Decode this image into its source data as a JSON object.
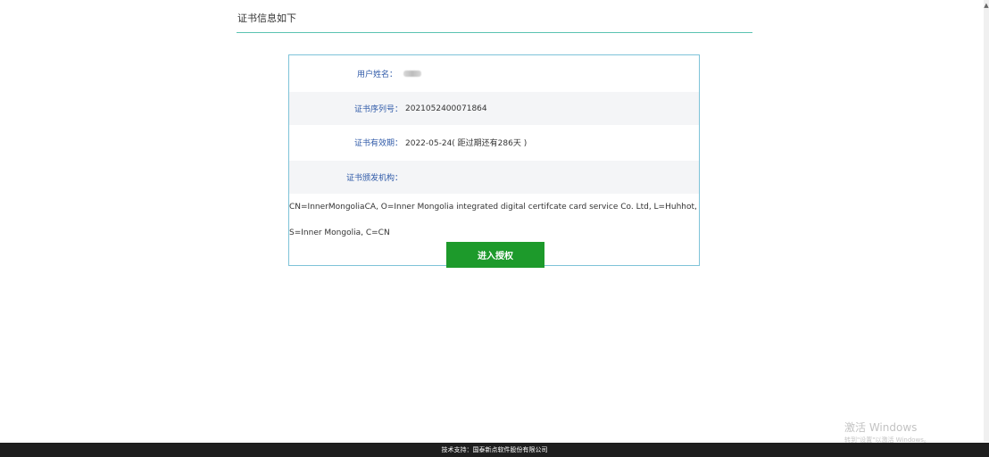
{
  "header": {
    "title": "证书信息如下"
  },
  "certificate": {
    "user_label": "用户姓名：",
    "serial_label": "证书序列号：",
    "serial_value": "2021052400071864",
    "validity_label": "证书有效期：",
    "validity_value": "2022-05-24( 距过期还有286天 )",
    "issuer_label": "证书颁发机构：",
    "issuer_value": "CN=InnerMongoliaCA, O=Inner Mongolia integrated digital certifcate card service Co. Ltd, L=Huhhot, S=Inner Mongolia, C=CN"
  },
  "actions": {
    "enter_auth_label": "进入授权"
  },
  "footer": {
    "text": "技术支持：国泰新点软件股份有限公司"
  },
  "watermark": {
    "line1": "激活 Windows",
    "line2": "转到\"设置\"以激活 Windows。"
  },
  "colors": {
    "accent_line": "#5bc3b2",
    "button": "#1d9a2b",
    "label": "#2f5aa8",
    "footer_bg": "#1e1e1e"
  }
}
